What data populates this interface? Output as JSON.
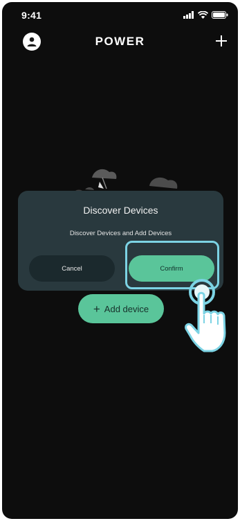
{
  "status_bar": {
    "time": "9:41"
  },
  "header": {
    "title": "POWER",
    "avatar_icon": "user-icon",
    "add_icon": "plus-icon"
  },
  "dialog": {
    "title": "Discover Devices",
    "message": "Discover Devices and Add Devices",
    "cancel_label": "Cancel",
    "confirm_label": "Confirm"
  },
  "main": {
    "add_device_label": "Add device",
    "add_device_icon": "plus-icon"
  },
  "colors": {
    "background": "#0d0d0d",
    "dialog": "#29393e",
    "accent_green": "#5ac59a",
    "highlight": "#7cd3e4"
  }
}
